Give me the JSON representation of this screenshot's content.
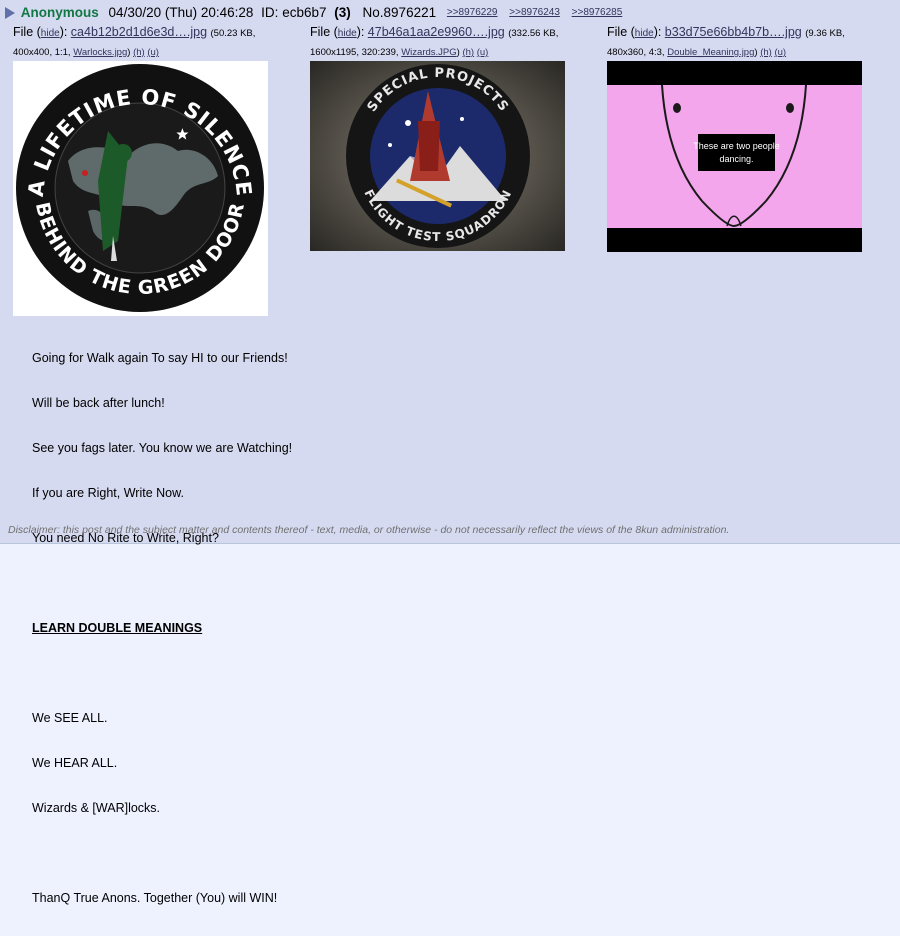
{
  "post": {
    "name": "Anonymous",
    "date": "04/30/20 (Thu) 20:46:28",
    "id_label": "ID:",
    "id_value": "ecb6b7",
    "reply_count": "(3)",
    "post_number": "No.8976221",
    "backlinks": [
      ">>8976229",
      ">>8976243",
      ">>8976285"
    ]
  },
  "files": [
    {
      "prefix": "File (",
      "hide": "hide",
      "sep": "): ",
      "filename": "ca4b12b2d1d6e3d….jpg",
      "size_prefix": "(50.23 KB,",
      "dims": "400x400, 1:1, ",
      "original": "Warlocks.jpg",
      "close": ")",
      "h": "(h)",
      "u": "(u)",
      "image_text": [
        "A LIFETIME OF SILENCE",
        "BEHIND THE GREEN DOOR"
      ]
    },
    {
      "prefix": "File (",
      "hide": "hide",
      "sep": "): ",
      "filename": "47b46a1aa2e9960….jpg",
      "size_prefix": "(332.56 KB,",
      "dims": "1600x1195, 320:239, ",
      "original": "Wizards.JPG",
      "close": ")",
      "h": "(h)",
      "u": "(u)",
      "image_text": [
        "SPECIAL PROJECTS",
        "FLIGHT TEST SQUADRON"
      ]
    },
    {
      "prefix": "File (",
      "hide": "hide",
      "sep": "): ",
      "filename": "b33d75e66bb4b7b….jpg",
      "size_prefix": "(9.36 KB,",
      "dims": "480x360, 4:3, ",
      "original": "Double_Meaning.jpg",
      "close": ")",
      "h": "(h)",
      "u": "(u)",
      "image_text": [
        "These are two people",
        "dancing."
      ]
    }
  ],
  "body": {
    "lines": [
      "Going for Walk again To say HI to our Friends!",
      "Will be back after lunch!",
      "See you fags later. You know we are Watching!",
      "If you are Right, Write Now.",
      "You need No Rite to Write, Right?",
      "",
      "LEARN DOUBLE MEANINGS",
      "",
      "We SEE ALL.",
      "We HEAR ALL.",
      "Wizards & [WAR]locks.",
      "",
      "ThanQ True Anons. Together (You) will WIN!"
    ],
    "heading_index": 6
  },
  "disclaimer": "Disclaimer: this post and the subject matter and contents thereof - text, media, or otherwise - do not necessarily reflect the views of the 8kun administration.",
  "colors": {
    "post_bg": "#d6daf0",
    "name": "#117743",
    "link": "#34345c",
    "arrow": "#6170a8",
    "disclaimer": "#707070"
  }
}
